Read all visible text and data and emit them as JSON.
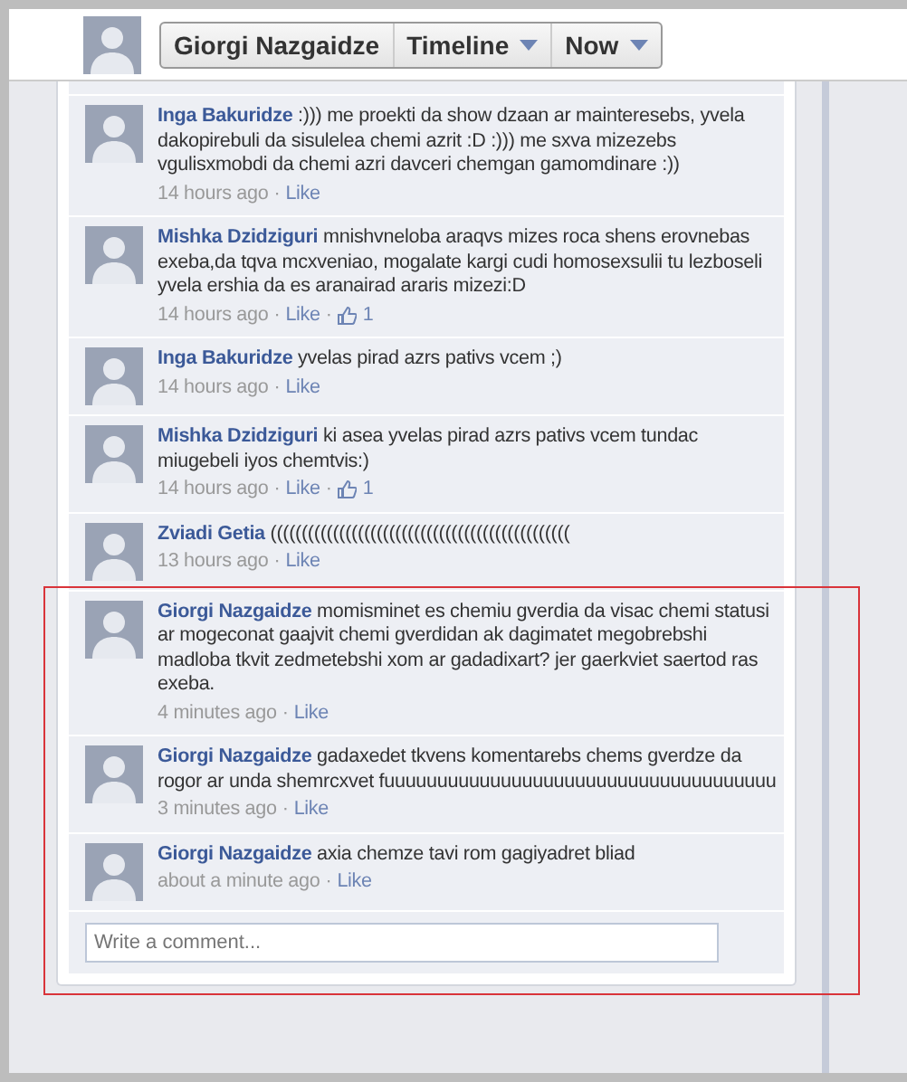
{
  "header": {
    "name": "Giorgi Nazgaidze",
    "menus": [
      {
        "label": "Timeline"
      },
      {
        "label": "Now"
      }
    ]
  },
  "comments": [
    {
      "author": "Inga Bakuridze",
      "text": ":))) me proekti da show dzaan ar mainteresebs, yvela dakopirebuli da sisulelea chemi azrit :D :))) me sxva mizezebs vgulisxmobdi da chemi azri davceri chemgan gamomdinare :))",
      "meta": [
        {
          "kind": "time",
          "text": "14 hours ago"
        },
        {
          "kind": "dot",
          "text": "·"
        },
        {
          "kind": "like",
          "text": "Like"
        }
      ]
    },
    {
      "author": "Mishka Dzidziguri",
      "text": "mnishvneloba araqvs mizes roca shens erovnebas exeba,da tqva mcxveniao, mogalate kargi cudi homosexsulii tu lezboseli yvela ershia da es aranairad araris mizezi:D",
      "meta": [
        {
          "kind": "time",
          "text": "14 hours ago"
        },
        {
          "kind": "dot",
          "text": "·"
        },
        {
          "kind": "like",
          "text": "Like"
        },
        {
          "kind": "dot",
          "text": "·"
        },
        {
          "kind": "likes",
          "text": "1"
        }
      ]
    },
    {
      "author": "Inga Bakuridze",
      "text": "yvelas pirad azrs pativs vcem ;)",
      "meta": [
        {
          "kind": "time",
          "text": "14 hours ago"
        },
        {
          "kind": "dot",
          "text": "·"
        },
        {
          "kind": "like",
          "text": "Like"
        }
      ]
    },
    {
      "author": "Mishka Dzidziguri",
      "text": "ki asea yvelas pirad azrs pativs vcem tundac miugebeli iyos chemtvis:)",
      "meta": [
        {
          "kind": "time",
          "text": "14 hours ago"
        },
        {
          "kind": "dot",
          "text": "·"
        },
        {
          "kind": "like",
          "text": "Like"
        },
        {
          "kind": "dot",
          "text": "·"
        },
        {
          "kind": "likes",
          "text": "1"
        }
      ]
    },
    {
      "author": "Zviadi Getia",
      "text": "((((((((((((((((((((((((((((((((((((((((((((((((",
      "meta": [
        {
          "kind": "time",
          "text": "13 hours ago"
        },
        {
          "kind": "dot",
          "text": "·"
        },
        {
          "kind": "like",
          "text": "Like"
        }
      ]
    }
  ],
  "highlighted_group": {
    "comments": [
      {
        "author": "Giorgi Nazgaidze",
        "text": "momisminet es chemiu gverdia da visac chemi statusi ar mogeconat gaajvit chemi gverdidan ak dagimatet megobrebshi madloba tkvit zedmetebshi xom ar gadadixart? jer gaerkviet saertod ras exeba.",
        "meta": [
          {
            "kind": "time",
            "text": "4 minutes ago"
          },
          {
            "kind": "dot",
            "text": "·"
          },
          {
            "kind": "like",
            "text": "Like"
          }
        ]
      },
      {
        "author": "Giorgi Nazgaidze",
        "text": "gadaxedet tkvens komentarebs chems gverdze da rogor ar unda shemrcxvet fuuuuuuuuuuuuuuuuuuuuuuuuuuuuuuuuuuuuu",
        "meta": [
          {
            "kind": "time",
            "text": "3 minutes ago"
          },
          {
            "kind": "dot",
            "text": "·"
          },
          {
            "kind": "like",
            "text": "Like"
          }
        ]
      },
      {
        "author": "Giorgi Nazgaidze",
        "text": "axia chemze tavi rom gagiyadret bliad",
        "meta": [
          {
            "kind": "time",
            "text": "about a minute ago"
          },
          {
            "kind": "dot",
            "text": "·"
          },
          {
            "kind": "like",
            "text": "Like"
          }
        ]
      }
    ],
    "composer": {
      "placeholder": "Write a comment..."
    }
  }
}
